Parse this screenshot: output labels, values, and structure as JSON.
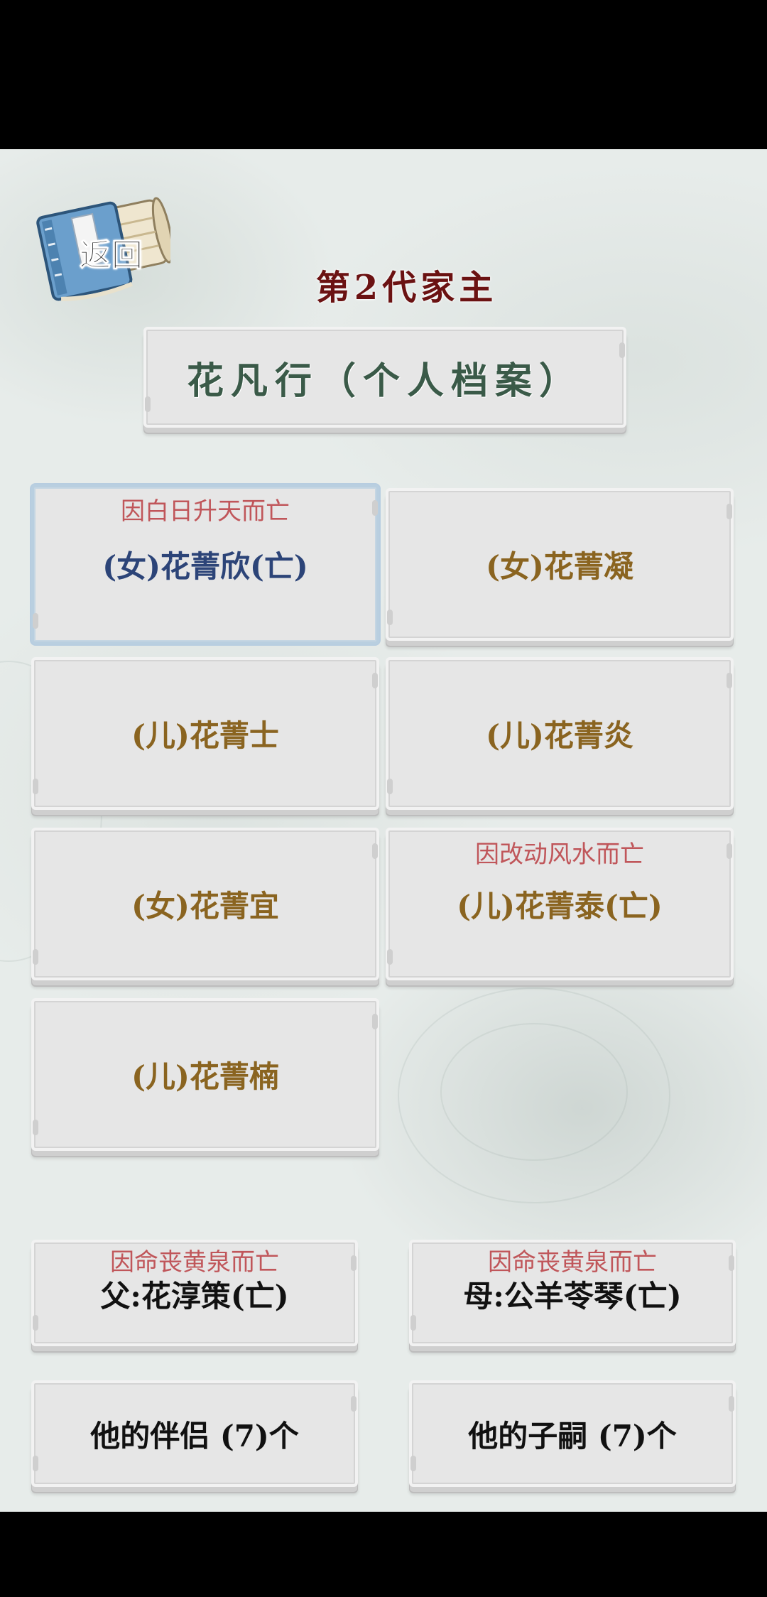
{
  "header": {
    "back_label": "返回",
    "generation_title": "第2代家主"
  },
  "profile": {
    "name_label": "花凡行（个人档案）"
  },
  "children": [
    {
      "name": "(女)花菁欣(亡)",
      "cause": "因白日升天而亡",
      "selected": true
    },
    {
      "name": "(女)花菁凝",
      "cause": ""
    },
    {
      "name": "(儿)花菁士",
      "cause": ""
    },
    {
      "name": "(儿)花菁炎",
      "cause": ""
    },
    {
      "name": "(女)花菁宜",
      "cause": ""
    },
    {
      "name": "(儿)花菁泰(亡)",
      "cause": "因改动风水而亡"
    },
    {
      "name": "(儿)花菁楠",
      "cause": ""
    }
  ],
  "parents": {
    "father": {
      "name": "父:花淳策(亡)",
      "cause": "因命丧黄泉而亡"
    },
    "mother": {
      "name": "母:公羊苓琴(亡)",
      "cause": "因命丧黄泉而亡"
    }
  },
  "summary": {
    "partners_label": "他的伴侣 (7)个",
    "children_label": "他的子嗣 (7)个"
  },
  "colors": {
    "title_red": "#6b1212",
    "profile_green": "#3a5a48",
    "child_gold": "#8a6420",
    "selected_blue": "#2c4478",
    "cause_red": "#c0565a",
    "panel_grey": "#e6e6e6"
  }
}
